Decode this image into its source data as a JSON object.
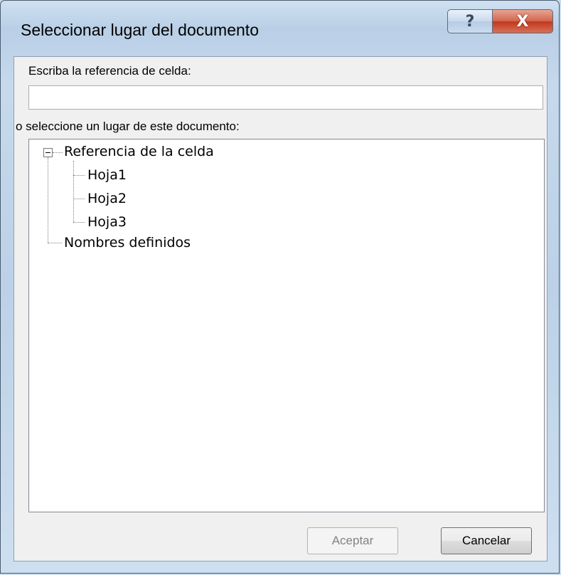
{
  "window": {
    "title": "Seleccionar lugar del documento",
    "help_glyph": "?",
    "close_glyph": "X"
  },
  "form": {
    "cell_ref_label": "Escriba la referencia de celda:",
    "cell_ref_value": "",
    "place_label": "o seleccione un lugar de este documento:"
  },
  "tree": {
    "root": "Referencia de la celda",
    "children": [
      "Hoja1",
      "Hoja2",
      "Hoja3"
    ],
    "names": "Nombres definidos"
  },
  "buttons": {
    "ok": "Aceptar",
    "cancel": "Cancelar"
  }
}
